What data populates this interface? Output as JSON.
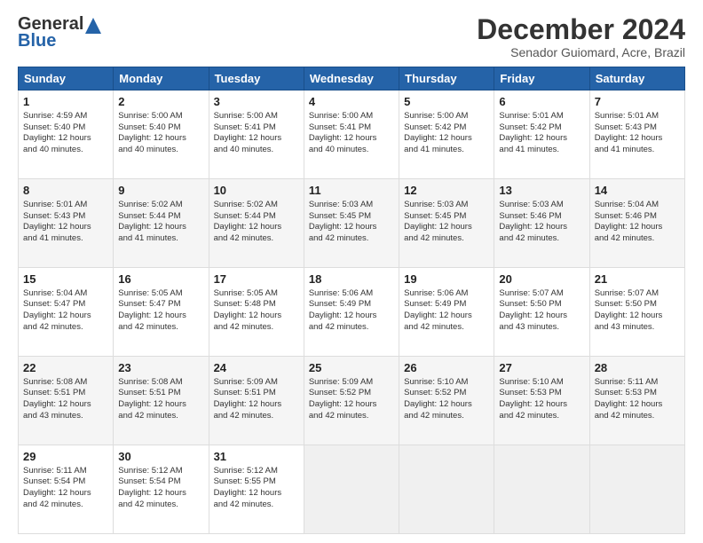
{
  "logo": {
    "line1": "General",
    "line2": "Blue"
  },
  "header": {
    "title": "December 2024",
    "subtitle": "Senador Guiomard, Acre, Brazil"
  },
  "weekdays": [
    "Sunday",
    "Monday",
    "Tuesday",
    "Wednesday",
    "Thursday",
    "Friday",
    "Saturday"
  ],
  "weeks": [
    [
      {
        "day": "1",
        "lines": [
          "Sunrise: 4:59 AM",
          "Sunset: 5:40 PM",
          "Daylight: 12 hours",
          "and 40 minutes."
        ]
      },
      {
        "day": "2",
        "lines": [
          "Sunrise: 5:00 AM",
          "Sunset: 5:40 PM",
          "Daylight: 12 hours",
          "and 40 minutes."
        ]
      },
      {
        "day": "3",
        "lines": [
          "Sunrise: 5:00 AM",
          "Sunset: 5:41 PM",
          "Daylight: 12 hours",
          "and 40 minutes."
        ]
      },
      {
        "day": "4",
        "lines": [
          "Sunrise: 5:00 AM",
          "Sunset: 5:41 PM",
          "Daylight: 12 hours",
          "and 40 minutes."
        ]
      },
      {
        "day": "5",
        "lines": [
          "Sunrise: 5:00 AM",
          "Sunset: 5:42 PM",
          "Daylight: 12 hours",
          "and 41 minutes."
        ]
      },
      {
        "day": "6",
        "lines": [
          "Sunrise: 5:01 AM",
          "Sunset: 5:42 PM",
          "Daylight: 12 hours",
          "and 41 minutes."
        ]
      },
      {
        "day": "7",
        "lines": [
          "Sunrise: 5:01 AM",
          "Sunset: 5:43 PM",
          "Daylight: 12 hours",
          "and 41 minutes."
        ]
      }
    ],
    [
      {
        "day": "8",
        "lines": [
          "Sunrise: 5:01 AM",
          "Sunset: 5:43 PM",
          "Daylight: 12 hours",
          "and 41 minutes."
        ]
      },
      {
        "day": "9",
        "lines": [
          "Sunrise: 5:02 AM",
          "Sunset: 5:44 PM",
          "Daylight: 12 hours",
          "and 41 minutes."
        ]
      },
      {
        "day": "10",
        "lines": [
          "Sunrise: 5:02 AM",
          "Sunset: 5:44 PM",
          "Daylight: 12 hours",
          "and 42 minutes."
        ]
      },
      {
        "day": "11",
        "lines": [
          "Sunrise: 5:03 AM",
          "Sunset: 5:45 PM",
          "Daylight: 12 hours",
          "and 42 minutes."
        ]
      },
      {
        "day": "12",
        "lines": [
          "Sunrise: 5:03 AM",
          "Sunset: 5:45 PM",
          "Daylight: 12 hours",
          "and 42 minutes."
        ]
      },
      {
        "day": "13",
        "lines": [
          "Sunrise: 5:03 AM",
          "Sunset: 5:46 PM",
          "Daylight: 12 hours",
          "and 42 minutes."
        ]
      },
      {
        "day": "14",
        "lines": [
          "Sunrise: 5:04 AM",
          "Sunset: 5:46 PM",
          "Daylight: 12 hours",
          "and 42 minutes."
        ]
      }
    ],
    [
      {
        "day": "15",
        "lines": [
          "Sunrise: 5:04 AM",
          "Sunset: 5:47 PM",
          "Daylight: 12 hours",
          "and 42 minutes."
        ]
      },
      {
        "day": "16",
        "lines": [
          "Sunrise: 5:05 AM",
          "Sunset: 5:47 PM",
          "Daylight: 12 hours",
          "and 42 minutes."
        ]
      },
      {
        "day": "17",
        "lines": [
          "Sunrise: 5:05 AM",
          "Sunset: 5:48 PM",
          "Daylight: 12 hours",
          "and 42 minutes."
        ]
      },
      {
        "day": "18",
        "lines": [
          "Sunrise: 5:06 AM",
          "Sunset: 5:49 PM",
          "Daylight: 12 hours",
          "and 42 minutes."
        ]
      },
      {
        "day": "19",
        "lines": [
          "Sunrise: 5:06 AM",
          "Sunset: 5:49 PM",
          "Daylight: 12 hours",
          "and 42 minutes."
        ]
      },
      {
        "day": "20",
        "lines": [
          "Sunrise: 5:07 AM",
          "Sunset: 5:50 PM",
          "Daylight: 12 hours",
          "and 43 minutes."
        ]
      },
      {
        "day": "21",
        "lines": [
          "Sunrise: 5:07 AM",
          "Sunset: 5:50 PM",
          "Daylight: 12 hours",
          "and 43 minutes."
        ]
      }
    ],
    [
      {
        "day": "22",
        "lines": [
          "Sunrise: 5:08 AM",
          "Sunset: 5:51 PM",
          "Daylight: 12 hours",
          "and 43 minutes."
        ]
      },
      {
        "day": "23",
        "lines": [
          "Sunrise: 5:08 AM",
          "Sunset: 5:51 PM",
          "Daylight: 12 hours",
          "and 42 minutes."
        ]
      },
      {
        "day": "24",
        "lines": [
          "Sunrise: 5:09 AM",
          "Sunset: 5:51 PM",
          "Daylight: 12 hours",
          "and 42 minutes."
        ]
      },
      {
        "day": "25",
        "lines": [
          "Sunrise: 5:09 AM",
          "Sunset: 5:52 PM",
          "Daylight: 12 hours",
          "and 42 minutes."
        ]
      },
      {
        "day": "26",
        "lines": [
          "Sunrise: 5:10 AM",
          "Sunset: 5:52 PM",
          "Daylight: 12 hours",
          "and 42 minutes."
        ]
      },
      {
        "day": "27",
        "lines": [
          "Sunrise: 5:10 AM",
          "Sunset: 5:53 PM",
          "Daylight: 12 hours",
          "and 42 minutes."
        ]
      },
      {
        "day": "28",
        "lines": [
          "Sunrise: 5:11 AM",
          "Sunset: 5:53 PM",
          "Daylight: 12 hours",
          "and 42 minutes."
        ]
      }
    ],
    [
      {
        "day": "29",
        "lines": [
          "Sunrise: 5:11 AM",
          "Sunset: 5:54 PM",
          "Daylight: 12 hours",
          "and 42 minutes."
        ]
      },
      {
        "day": "30",
        "lines": [
          "Sunrise: 5:12 AM",
          "Sunset: 5:54 PM",
          "Daylight: 12 hours",
          "and 42 minutes."
        ]
      },
      {
        "day": "31",
        "lines": [
          "Sunrise: 5:12 AM",
          "Sunset: 5:55 PM",
          "Daylight: 12 hours",
          "and 42 minutes."
        ]
      },
      {
        "day": "",
        "lines": []
      },
      {
        "day": "",
        "lines": []
      },
      {
        "day": "",
        "lines": []
      },
      {
        "day": "",
        "lines": []
      }
    ]
  ]
}
